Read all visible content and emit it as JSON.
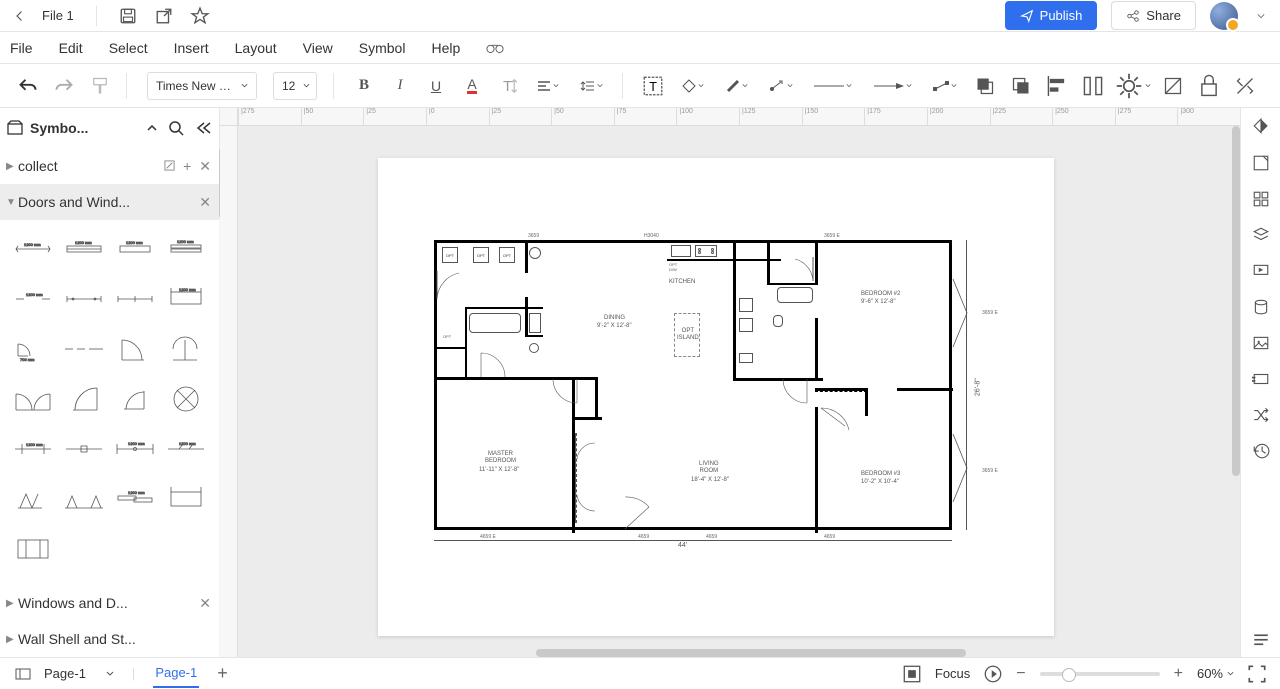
{
  "file": {
    "name": "File 1"
  },
  "actions": {
    "publish": "Publish",
    "share": "Share"
  },
  "menu": [
    "File",
    "Edit",
    "Select",
    "Insert",
    "Layout",
    "View",
    "Symbol",
    "Help"
  ],
  "toolbar": {
    "font": "Times New Ro...",
    "size": "12"
  },
  "left_panel": {
    "title": "Symbo...",
    "cats": {
      "collect": "collect",
      "doors": "Doors and Wind...",
      "windows": "Windows and D...",
      "wall": "Wall Shell and St..."
    }
  },
  "ruler": [
    "|275",
    "|50",
    "|25",
    "|0",
    "|25",
    "|50",
    "|75",
    "|100",
    "|125",
    "|150",
    "|175",
    "|200",
    "|225",
    "|250",
    "|275",
    "|300"
  ],
  "floorplan": {
    "dims": {
      "width_label": "44'",
      "height_label": "26'-8\"",
      "top_center": "H3040",
      "top_left_dim": "3659",
      "top_right_dim": "3659 E",
      "right_upper": "3659 E",
      "right_lower": "3659 E",
      "bottom_a": "4659 E",
      "bottom_b": "4659",
      "bottom_c": "4659",
      "bottom_d": "4659",
      "bottom_e": "4659"
    },
    "rooms": {
      "kitchen": "KITCHEN",
      "dining": "DINING",
      "dining_dim": "9'-2\" X 12'-8\"",
      "island": "OPT\nISLAND",
      "bed2": "BEDROOM #2",
      "bed2_dim": "9'-6\" X 12'-8\"",
      "master": "MASTER\nBEDROOM",
      "master_dim": "11'-11\" X 12'-8\"",
      "living": "LIVING\nROOM",
      "living_dim": "18'-4\" X 12'-8\"",
      "bed3": "BEDROOM #3",
      "bed3_dim": "10'-2\" X 10'-4\""
    },
    "tags": {
      "opt": "OPT",
      "opt_dw": "OPT\nD/W"
    }
  },
  "status": {
    "page_dropdown": "Page-1",
    "page_tab": "Page-1",
    "focus": "Focus",
    "zoom": "60%"
  }
}
